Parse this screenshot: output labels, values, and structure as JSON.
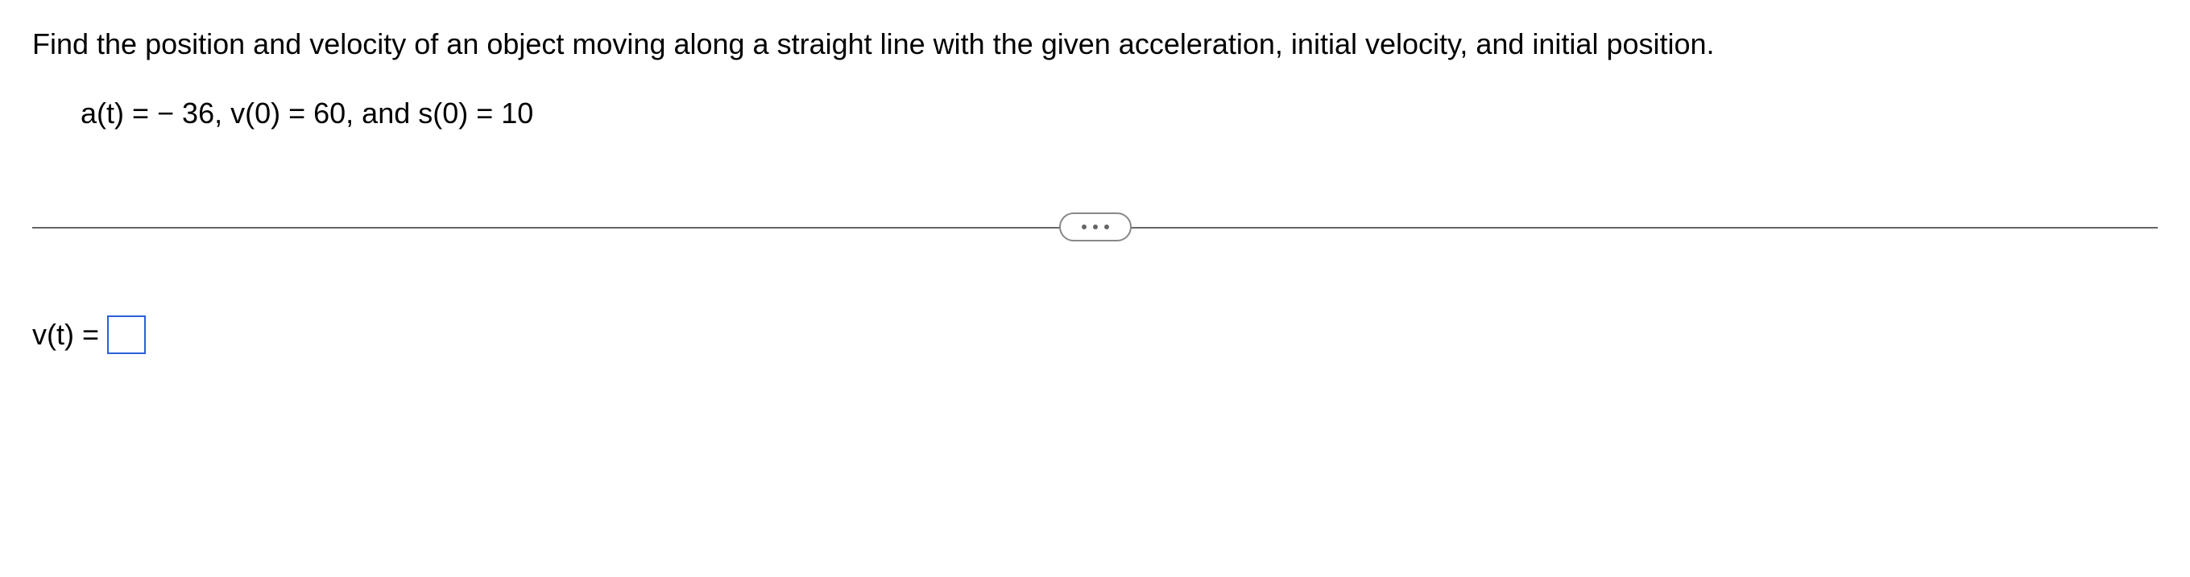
{
  "question": {
    "prompt": "Find the position and velocity of an object moving along a straight line with the given acceleration, initial velocity, and initial position.",
    "equation": "a(t) = − 36, v(0) = 60, and s(0) = 10"
  },
  "answer": {
    "label": "v(t) =",
    "value": ""
  }
}
